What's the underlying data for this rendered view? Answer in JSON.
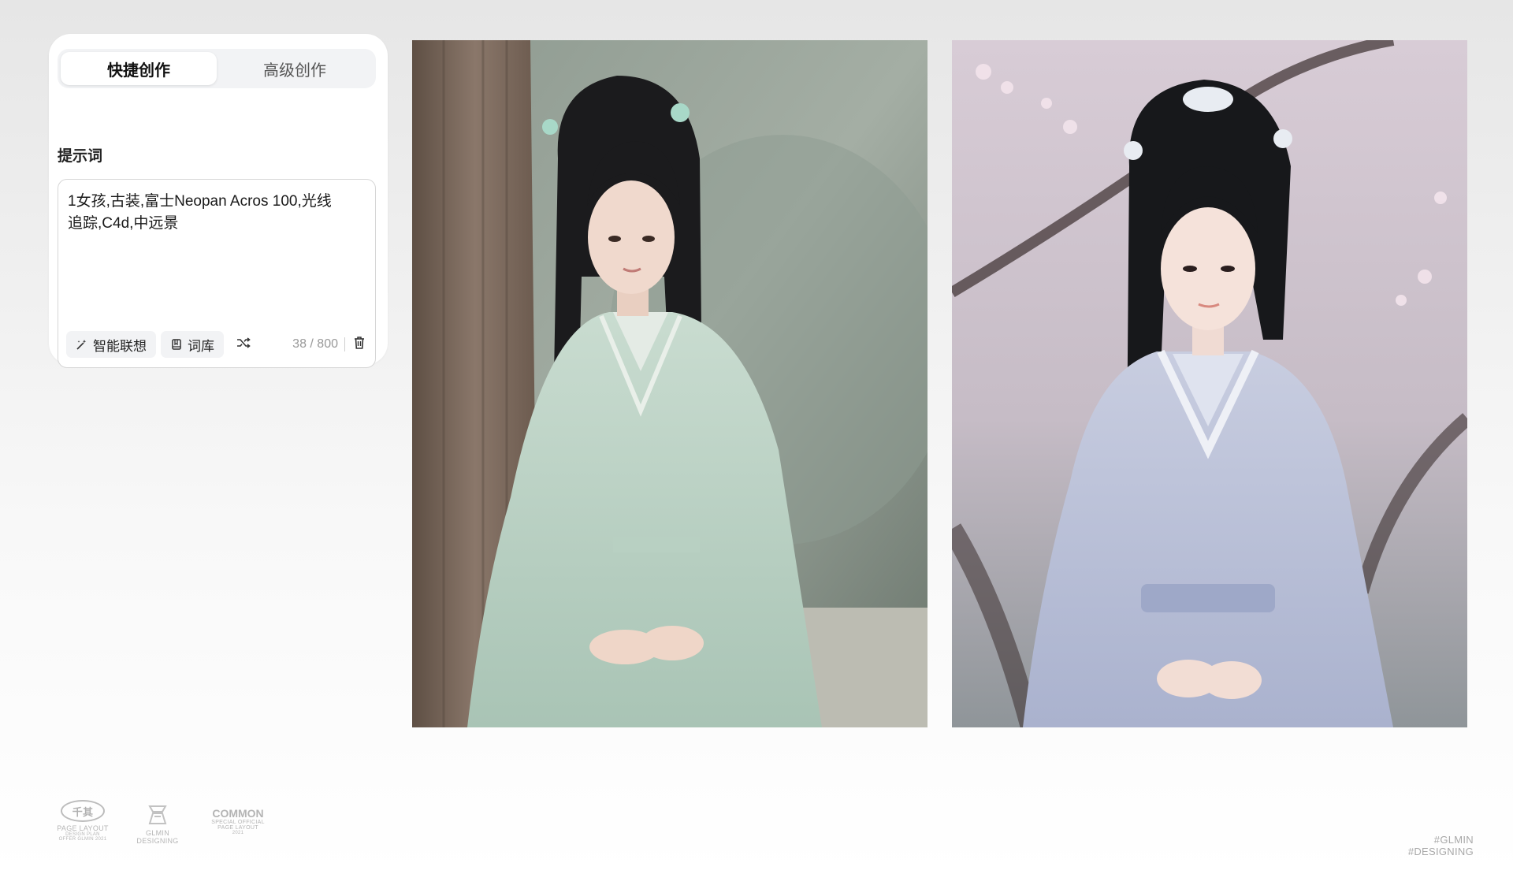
{
  "panel": {
    "tabs": [
      {
        "label": "快捷创作",
        "active": true
      },
      {
        "label": "高级创作",
        "active": false
      }
    ],
    "prompt_label": "提示词",
    "prompt_value": "1女孩,古装,富士Neopan Acros 100,光线追踪,C4d,中远景",
    "toolbar": {
      "smart_label": "智能联想",
      "smart_icon": "magic-wand-icon",
      "library_label": "词库",
      "library_icon": "book-icon",
      "shuffle_icon": "shuffle-icon",
      "counter": "38 / 800",
      "delete_icon": "trash-icon"
    }
  },
  "footer": {
    "logo1": {
      "mark": "千其",
      "line1": "PAGE LAYOUT",
      "line2": "DESIGN PLAN",
      "line3": "OFFER GLMIN 2021"
    },
    "logo2": {
      "line1": "GLMIN",
      "line2": "DESIGNING"
    },
    "logo3": {
      "big": "COMMON",
      "line1": "SPECIAL OFFICIAL",
      "line2": "PAGE LAYOUT",
      "line3": "2021"
    },
    "tag1": "#GLMIN",
    "tag2": "#DESIGNING"
  },
  "colors": {
    "panel_bg": "#ffffff",
    "tab_track": "#f2f3f5",
    "muted_text": "#999999"
  }
}
